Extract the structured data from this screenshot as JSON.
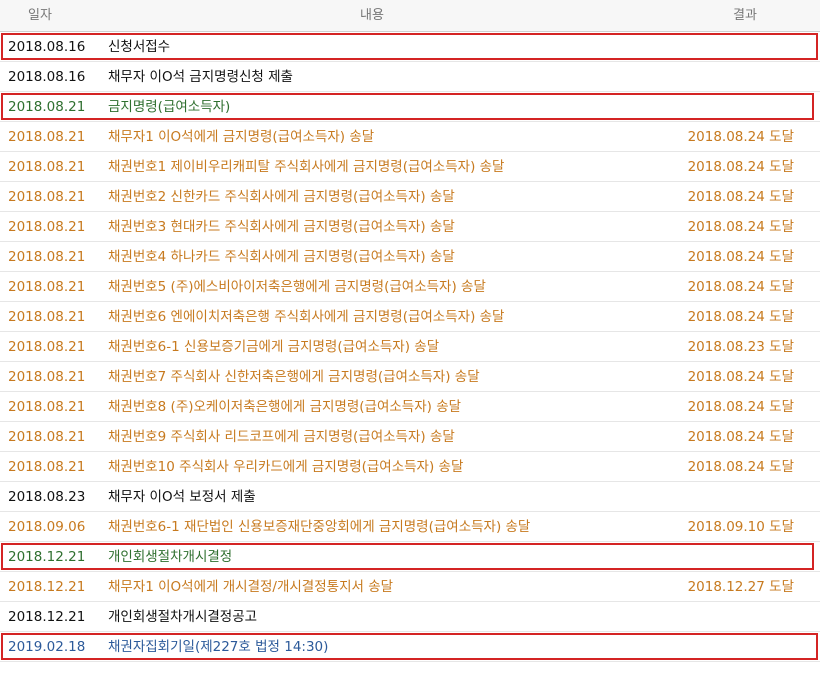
{
  "header": {
    "date": "일자",
    "content": "내용",
    "result": "결과"
  },
  "rows": [
    {
      "date": "2018.08.16",
      "content": "신청서접수",
      "result": ""
    },
    {
      "date": "2018.08.16",
      "content": "채무자 이O석 금지명령신청 제출",
      "result": ""
    },
    {
      "date": "2018.08.21",
      "content": "금지명령(급여소득자)",
      "result": ""
    },
    {
      "date": "2018.08.21",
      "content": "채무자1 이O석에게 금지명령(급여소득자) 송달",
      "result": "2018.08.24 도달"
    },
    {
      "date": "2018.08.21",
      "content": "채권번호1 제이비우리캐피탈 주식회사에게 금지명령(급여소득자) 송달",
      "result": "2018.08.24 도달"
    },
    {
      "date": "2018.08.21",
      "content": "채권번호2 신한카드 주식회사에게 금지명령(급여소득자) 송달",
      "result": "2018.08.24 도달"
    },
    {
      "date": "2018.08.21",
      "content": "채권번호3 현대카드 주식회사에게 금지명령(급여소득자) 송달",
      "result": "2018.08.24 도달"
    },
    {
      "date": "2018.08.21",
      "content": "채권번호4 하나카드 주식회사에게 금지명령(급여소득자) 송달",
      "result": "2018.08.24 도달"
    },
    {
      "date": "2018.08.21",
      "content": "채권번호5 (주)에스비아이저축은행에게 금지명령(급여소득자) 송달",
      "result": "2018.08.24 도달"
    },
    {
      "date": "2018.08.21",
      "content": "채권번호6 엔에이치저축은행 주식회사에게 금지명령(급여소득자) 송달",
      "result": "2018.08.24 도달"
    },
    {
      "date": "2018.08.21",
      "content": "채권번호6-1 신용보증기금에게 금지명령(급여소득자) 송달",
      "result": "2018.08.23 도달"
    },
    {
      "date": "2018.08.21",
      "content": "채권번호7 주식회사 신한저축은행에게 금지명령(급여소득자) 송달",
      "result": "2018.08.24 도달"
    },
    {
      "date": "2018.08.21",
      "content": "채권번호8 (주)오케이저축은행에게 금지명령(급여소득자) 송달",
      "result": "2018.08.24 도달"
    },
    {
      "date": "2018.08.21",
      "content": "채권번호9 주식회사 리드코프에게 금지명령(급여소득자) 송달",
      "result": "2018.08.24 도달"
    },
    {
      "date": "2018.08.21",
      "content": "채권번호10 주식회사 우리카드에게 금지명령(급여소득자) 송달",
      "result": "2018.08.24 도달"
    },
    {
      "date": "2018.08.23",
      "content": "채무자 이O석 보정서 제출",
      "result": ""
    },
    {
      "date": "2018.09.06",
      "content": "채권번호6-1 재단법인 신용보증재단중앙회에게 금지명령(급여소득자) 송달",
      "result": "2018.09.10 도달"
    },
    {
      "date": "2018.12.21",
      "content": "개인회생절차개시결정",
      "result": ""
    },
    {
      "date": "2018.12.21",
      "content": "채무자1 이O석에게 개시결정/개시결정통지서 송달",
      "result": "2018.12.27 도달"
    },
    {
      "date": "2018.12.21",
      "content": "개인회생절차개시결정공고",
      "result": ""
    },
    {
      "date": "2019.02.18",
      "content": "채권자집회기일(제227호 법정 14:30)",
      "result": ""
    }
  ],
  "colors": {
    "black": "#111111",
    "green": "#2f6f2f",
    "orange": "#c77a1f",
    "blue": "#2c5a9a",
    "highlight_border": "#d42424"
  }
}
